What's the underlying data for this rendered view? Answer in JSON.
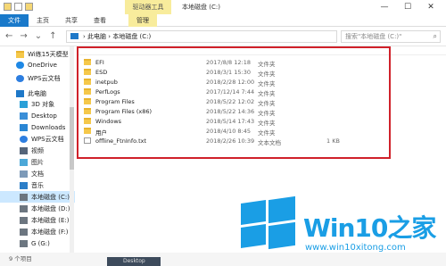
{
  "titlebar": {
    "context_tab": "驱动器工具",
    "title": "本地磁盘 (C:)",
    "window_buttons": [
      "—",
      "☐",
      "✕"
    ]
  },
  "ribbon_tabs": [
    "文件",
    "主页",
    "共享",
    "查看",
    "管理"
  ],
  "address": {
    "path": [
      "此电脑",
      "本地磁盘 (C:)"
    ],
    "path_sep": "›",
    "search_placeholder": "搜索\"本地磁盘 (C:)\""
  },
  "sidebar": {
    "items": [
      {
        "label": "Wi练15天模型",
        "icon": "folder-icon"
      },
      {
        "label": "OneDrive",
        "icon": "cloud-icon"
      },
      {
        "label": "WPS云文档",
        "icon": "wps-icon"
      },
      {
        "label": "此电脑",
        "icon": "pc-icon"
      },
      {
        "label": "3D 对象",
        "icon": "3d-objects-icon"
      },
      {
        "label": "Desktop",
        "icon": "desktop-icon"
      },
      {
        "label": "Downloads",
        "icon": "downloads-icon"
      },
      {
        "label": "WPS云文档",
        "icon": "wps-icon"
      },
      {
        "label": "视频",
        "icon": "video-icon"
      },
      {
        "label": "图片",
        "icon": "picture-icon"
      },
      {
        "label": "文档",
        "icon": "document-icon"
      },
      {
        "label": "音乐",
        "icon": "music-icon"
      },
      {
        "label": "本地磁盘 (C:)",
        "icon": "drive-icon",
        "active": true
      },
      {
        "label": "本地磁盘 (D:)",
        "icon": "drive-icon"
      },
      {
        "label": "本地磁盘 (E:)",
        "icon": "drive-icon"
      },
      {
        "label": "本地磁盘 (F:)",
        "icon": "drive-icon"
      },
      {
        "label": "G (G:)",
        "icon": "drive-icon"
      }
    ]
  },
  "files": [
    {
      "name": "EFI",
      "date": "2017/8/8 12:18",
      "type": "文件夹",
      "size": "",
      "icon": "folder-icon"
    },
    {
      "name": "ESD",
      "date": "2018/3/1 15:30",
      "type": "文件夹",
      "size": "",
      "icon": "folder-icon"
    },
    {
      "name": "inetpub",
      "date": "2018/2/28 12:00",
      "type": "文件夹",
      "size": "",
      "icon": "folder-icon"
    },
    {
      "name": "PerfLogs",
      "date": "2017/12/14 7:44",
      "type": "文件夹",
      "size": "",
      "icon": "folder-icon"
    },
    {
      "name": "Program Files",
      "date": "2018/5/22 12:02",
      "type": "文件夹",
      "size": "",
      "icon": "folder-icon"
    },
    {
      "name": "Program Files (x86)",
      "date": "2018/5/22 14:36",
      "type": "文件夹",
      "size": "",
      "icon": "folder-icon"
    },
    {
      "name": "Windows",
      "date": "2018/5/14 17:43",
      "type": "文件夹",
      "size": "",
      "icon": "folder-icon"
    },
    {
      "name": "用户",
      "date": "2018/4/10 8:45",
      "type": "文件夹",
      "size": "",
      "icon": "folder-icon"
    },
    {
      "name": "offline_FtnInfo.txt",
      "date": "2018/2/26 10:39",
      "type": "文本文档",
      "size": "1 KB",
      "icon": "text-file-icon"
    }
  ],
  "status": {
    "count": "9 个项目"
  },
  "taskbar": {
    "label": "Desktop"
  },
  "watermark": {
    "brand": "Win10之家",
    "url": "www.win10xitong.com"
  },
  "colors": {
    "accent": "#1979ca",
    "highlight": "#cce8ff",
    "annotation": "#d0212a",
    "brand": "#1a9ee5"
  }
}
